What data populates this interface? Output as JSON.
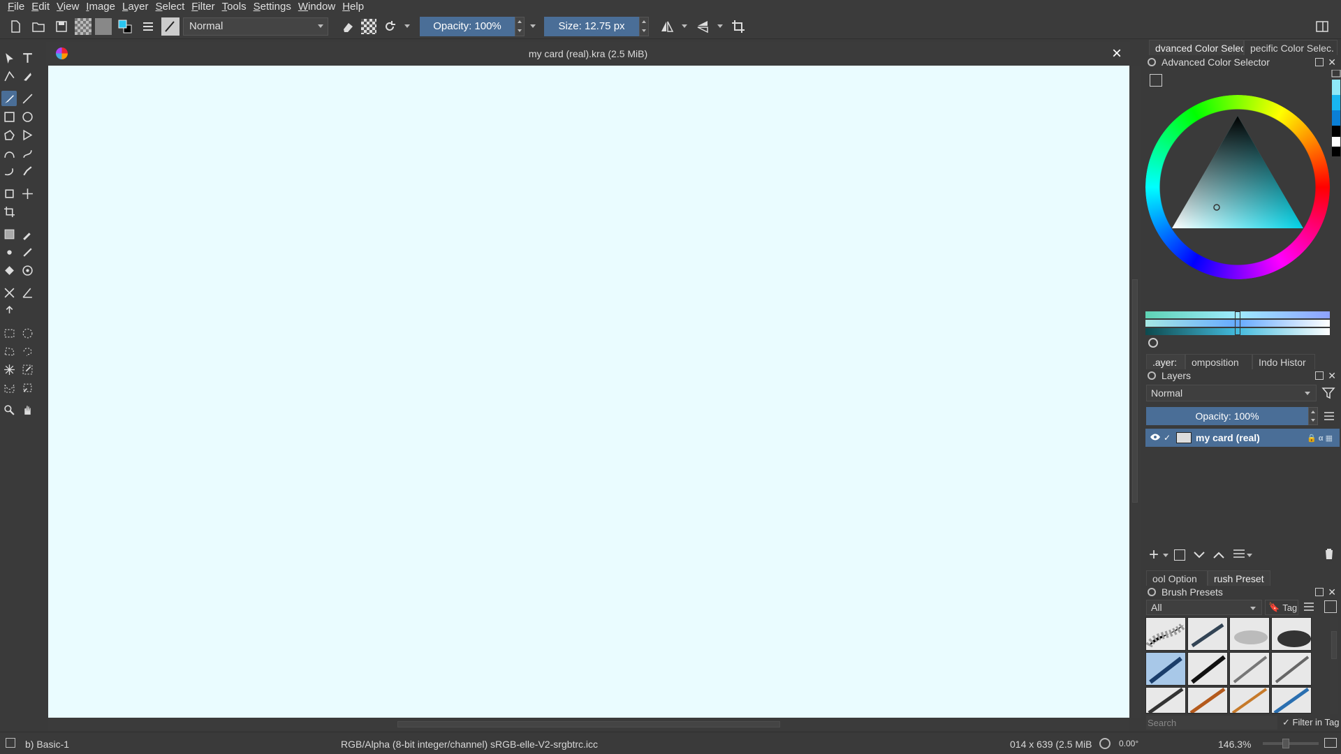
{
  "menu": [
    "File",
    "Edit",
    "View",
    "Image",
    "Layer",
    "Select",
    "Filter",
    "Tools",
    "Settings",
    "Window",
    "Help"
  ],
  "toolbar": {
    "blend_mode": "Normal",
    "opacity": "Opacity: 100%",
    "size": "Size: 12.75 px"
  },
  "document": {
    "title": "my card (real).kra (2.5 MiB)",
    "canvas_color": "#eafcff"
  },
  "docker": {
    "color_tabs": [
      "dvanced Color Selec",
      "pecific Color Selec."
    ],
    "color_title": "Advanced Color Selector",
    "layer_tabs": [
      ".ayer:",
      "omposition",
      "Indo Histor"
    ],
    "layers_title": "Layers",
    "layer_blend": "Normal",
    "layer_opacity": "Opacity:  100%",
    "layers": [
      {
        "name": "my card (real)",
        "selected": true
      }
    ],
    "brush_tabs": [
      "ool Option",
      "rush Preset"
    ],
    "brush_title": "Brush Presets",
    "brush_filter": "All",
    "tag_label": "Tag",
    "search_placeholder": "Search",
    "filter_in_tag": "Filter in Tag"
  },
  "status": {
    "brush": "b) Basic-1",
    "colorspace": "RGB/Alpha (8-bit integer/channel)  sRGB-elle-V2-srgbtrc.icc",
    "dims": "014 x 639 (2.5 MiB",
    "rotation": "0.00°",
    "zoom": "146.3%"
  },
  "colors": {
    "accent": "#4a6e97",
    "panel": "#3a3a3a"
  }
}
